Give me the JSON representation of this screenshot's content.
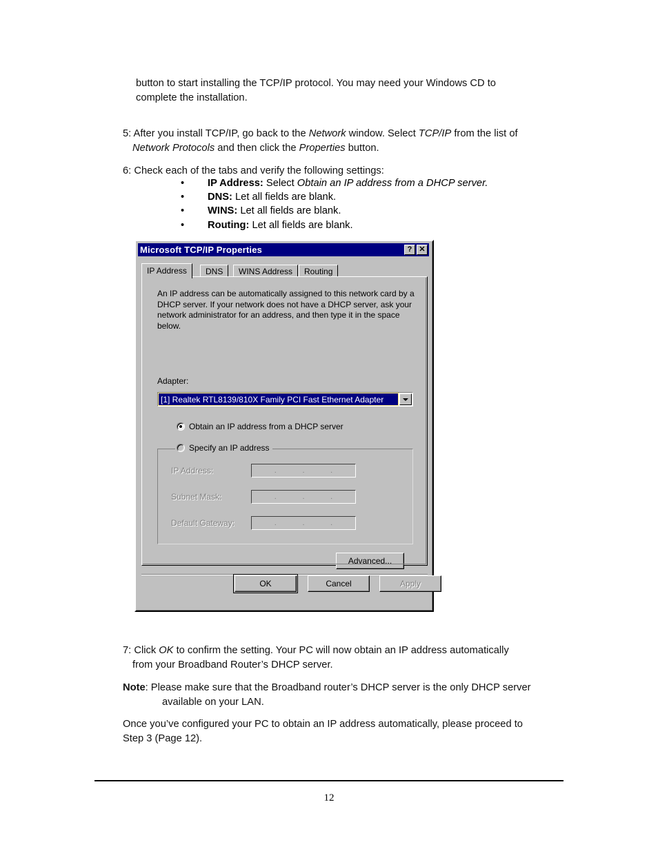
{
  "document": {
    "page_number": "12",
    "paragraphs": {
      "intro_line1": "button to start installing the TCP/IP protocol. You may need your Windows CD to",
      "intro_line2": "complete the installation.",
      "step5_num": "5:",
      "step5_a": "After you install TCP/IP, go back to the ",
      "step5_i1": "Network",
      "step5_b": " window. Select ",
      "step5_i2": "TCP/IP",
      "step5_c": " from the list of",
      "step5_i3": "Network Protocols",
      "step5_d": " and then click the ",
      "step5_i4": "Properties",
      "step5_e": " button.",
      "step6_num": "6:",
      "step6_text": "Check each of the tabs and verify the following settings:",
      "step7_num": "7:",
      "step7_a": "Click ",
      "step7_i1": "OK",
      "step7_b": " to confirm the setting. Your PC will now obtain an IP address automatically",
      "step7_c": "from your Broadband Router’s DHCP server.",
      "note_label": "Note",
      "note_a": ": Please make sure that the Broadband router’s DHCP server is the only DHCP server",
      "note_b": "available on your LAN.",
      "closing_a": "Once you’ve configured your PC to obtain an IP address automatically, please proceed to",
      "closing_b": "Step 3 (Page 12)."
    },
    "bullets": [
      {
        "marker": "•",
        "term": "IP Address:",
        "text": " Select ",
        "italic": "Obtain an IP address from a DHCP server."
      },
      {
        "marker": "•",
        "term": "DNS:",
        "text": " Let all fields are blank.",
        "italic": ""
      },
      {
        "marker": "•",
        "term": "WINS:",
        "text": " Let all fields are blank.",
        "italic": ""
      },
      {
        "marker": "•",
        "term": "Routing:",
        "text": " Let all fields are blank.",
        "italic": ""
      }
    ]
  },
  "dialog": {
    "title": "Microsoft TCP/IP Properties",
    "titlebar_buttons": {
      "help": "?",
      "close": "✕"
    },
    "tabs": [
      {
        "label": "IP Address",
        "active": true
      },
      {
        "label": "DNS",
        "active": false
      },
      {
        "label": "WINS Address",
        "active": false
      },
      {
        "label": "Routing",
        "active": false
      }
    ],
    "description": "An IP address can be automatically assigned to this network card by a DHCP server.  If your network does not have a DHCP server, ask your network administrator for an address, and then type it in the space below.",
    "adapter_label": "Adapter:",
    "adapter_value": "[1] Realtek RTL8139/810X Family PCI Fast Ethernet Adapter",
    "radio_dhcp_label": "Obtain an IP address from a DHCP server",
    "radio_dhcp_checked": true,
    "radio_specify_label": "Specify an IP address",
    "radio_specify_checked": false,
    "fields": [
      {
        "label": "IP Address:",
        "value": "",
        "enabled": false
      },
      {
        "label": "Subnet Mask:",
        "value": "",
        "enabled": false
      },
      {
        "label": "Default Gateway:",
        "value": "",
        "enabled": false
      }
    ],
    "ip_separator": ".",
    "buttons": {
      "advanced": "Advanced...",
      "ok": "OK",
      "cancel": "Cancel",
      "apply": "Apply"
    },
    "colors": {
      "titlebar": "#000080",
      "face": "#c0c0c0",
      "highlight_text": "#ffffff",
      "disabled_text": "#808080"
    }
  }
}
